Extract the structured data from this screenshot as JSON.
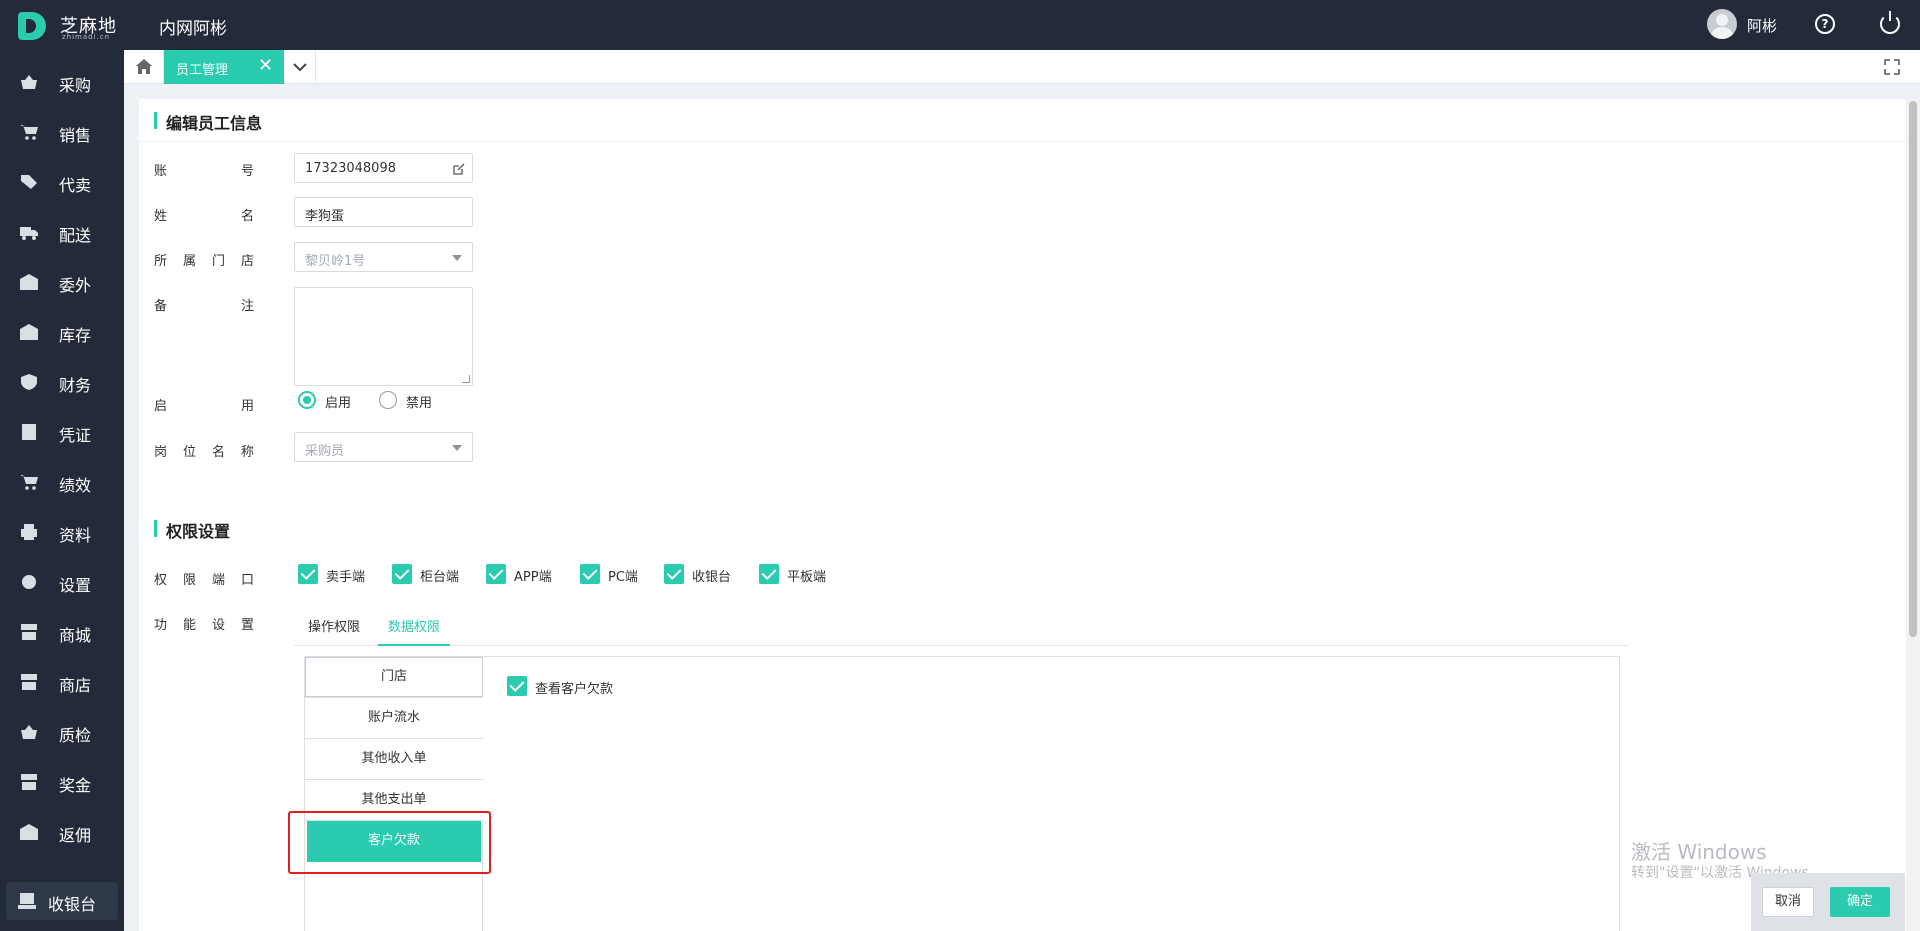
{
  "header": {
    "logo_text": "芝麻地",
    "logo_sub": "zhimadi.cn",
    "app_title": "内网阿彬",
    "user_name": "阿彬"
  },
  "sidebar": {
    "items": [
      {
        "label": "采购",
        "icon": "basket-icon"
      },
      {
        "label": "销售",
        "icon": "cart-icon"
      },
      {
        "label": "代卖",
        "icon": "tag-icon"
      },
      {
        "label": "配送",
        "icon": "truck-icon"
      },
      {
        "label": "委外",
        "icon": "warehouse-icon"
      },
      {
        "label": "库存",
        "icon": "warehouse-icon"
      },
      {
        "label": "财务",
        "icon": "yen-shield-icon"
      },
      {
        "label": "凭证",
        "icon": "voucher-icon"
      },
      {
        "label": "绩效",
        "icon": "cart-icon"
      },
      {
        "label": "资料",
        "icon": "printer-icon"
      },
      {
        "label": "设置",
        "icon": "gear-icon"
      },
      {
        "label": "商城",
        "icon": "store-icon"
      },
      {
        "label": "商店",
        "icon": "store-icon"
      },
      {
        "label": "质检",
        "icon": "basket-icon"
      },
      {
        "label": "奖金",
        "icon": "store-icon"
      },
      {
        "label": "返佣",
        "icon": "warehouse-icon"
      }
    ],
    "cashier_label": "收银台"
  },
  "tabs": {
    "active_label": "员工管理",
    "close_glyph": "✕"
  },
  "form": {
    "section_title": "编辑员工信息",
    "account_label": [
      "账",
      "号"
    ],
    "account_value": "17323048098",
    "name_label": [
      "姓",
      "名"
    ],
    "name_value": "李狗蛋",
    "store_label": [
      "所",
      "属",
      "门",
      "店"
    ],
    "store_placeholder": "黎贝岭1号",
    "remark_label": [
      "备",
      "注"
    ],
    "enable_label": [
      "启",
      "用"
    ],
    "enable_on": "启用",
    "enable_off": "禁用",
    "position_label": [
      "岗",
      "位",
      "名",
      "称"
    ],
    "position_placeholder": "采购员"
  },
  "permissions": {
    "section_title": "权限设置",
    "port_label": [
      "权",
      "限",
      "端",
      "口"
    ],
    "ports": [
      "卖手端",
      "柜台端",
      "APP端",
      "PC端",
      "收银台",
      "平板端"
    ],
    "function_label": [
      "功",
      "能",
      "设",
      "置"
    ],
    "subtabs": [
      "操作权限",
      "数据权限"
    ],
    "list": [
      "门店",
      "账户流水",
      "其他收入单",
      "其他支出单",
      "客户欠款"
    ],
    "selected_item": "客户欠款",
    "option_label": "查看客户欠款"
  },
  "watermark": {
    "line1": "激活 Windows",
    "line2": "转到\"设置\"以激活 Windows。"
  },
  "footer": {
    "cancel": "取消",
    "ok": "确定"
  },
  "colors": {
    "accent": "#2bcbb0",
    "topbar": "#232b3a",
    "highlight": "#e02020"
  }
}
